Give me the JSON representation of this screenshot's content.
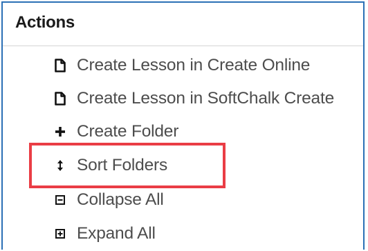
{
  "panel": {
    "title": "Actions"
  },
  "actions": [
    {
      "label": "Create Lesson in Create Online",
      "icon": "document-icon"
    },
    {
      "label": "Create Lesson in SoftChalk Create",
      "icon": "document-icon"
    },
    {
      "label": "Create Folder",
      "icon": "plus-icon"
    },
    {
      "label": "Sort Folders",
      "icon": "sort-arrows-icon"
    },
    {
      "label": "Collapse All",
      "icon": "collapse-box-icon"
    },
    {
      "label": "Expand All",
      "icon": "expand-box-icon"
    }
  ],
  "highlight_color": "#ea3d45",
  "border_color": "#2a6fb5"
}
